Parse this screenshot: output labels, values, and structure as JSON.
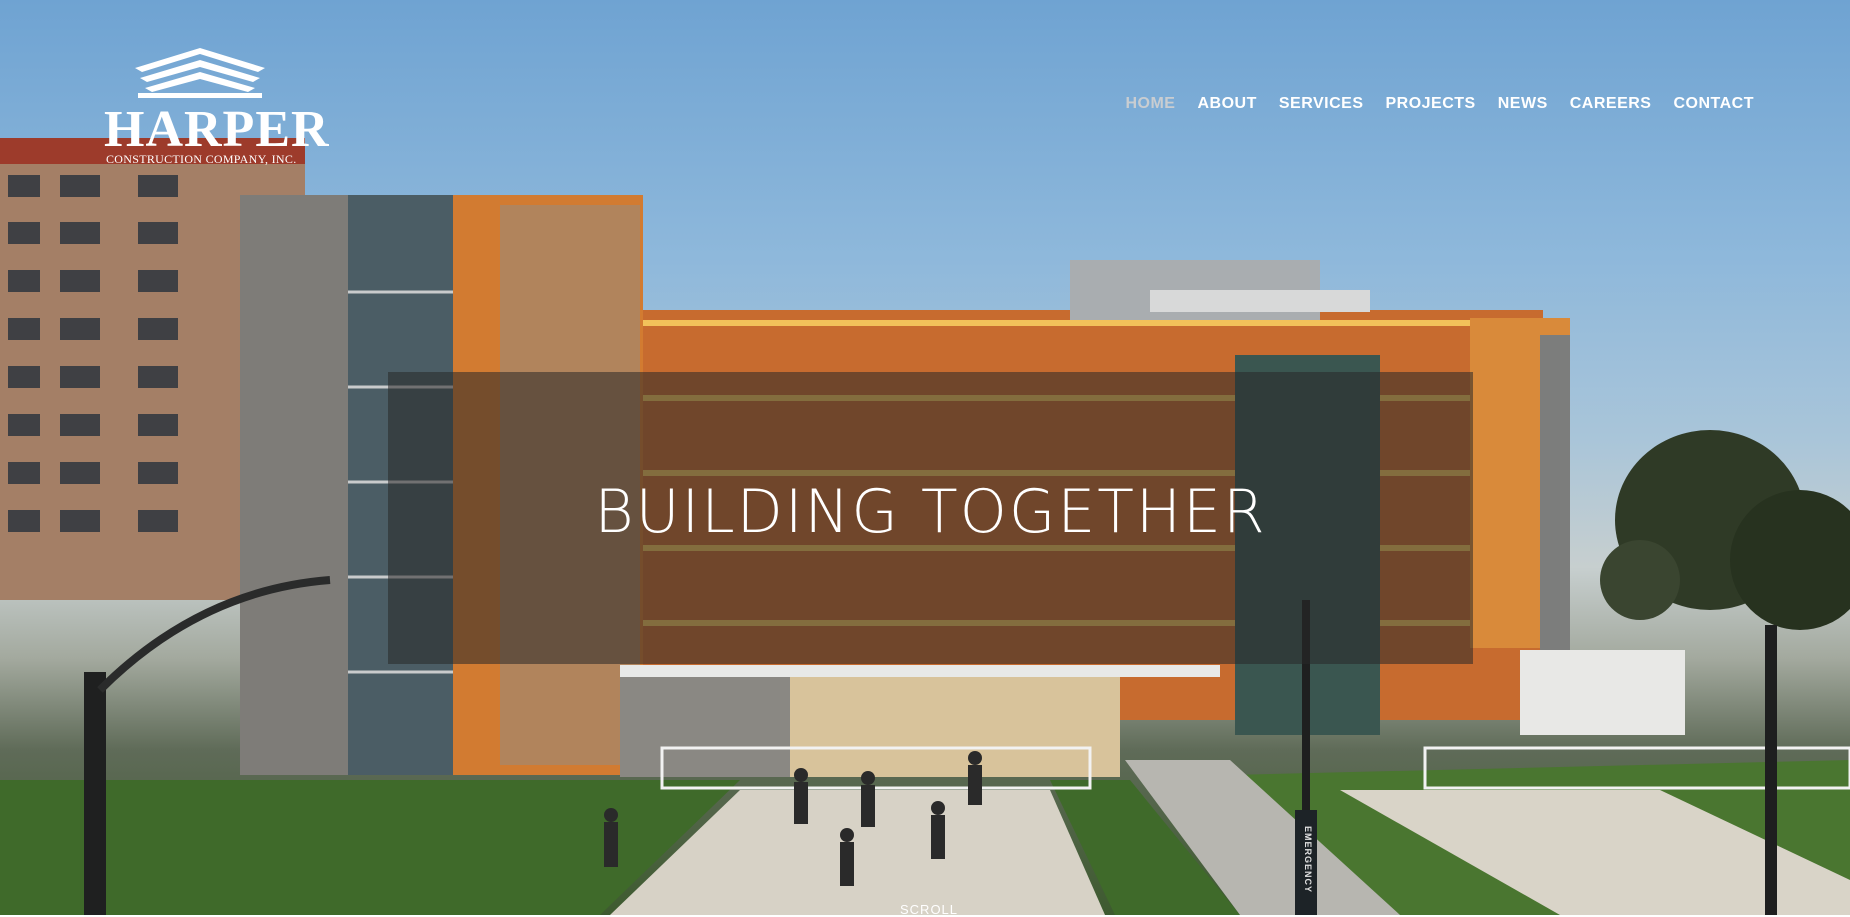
{
  "brand": {
    "name": "HARPER",
    "tagline": "CONSTRUCTION COMPANY, INC."
  },
  "nav": {
    "items": [
      {
        "label": "HOME",
        "active": true
      },
      {
        "label": "ABOUT",
        "active": false
      },
      {
        "label": "SERVICES",
        "active": false
      },
      {
        "label": "PROJECTS",
        "active": false
      },
      {
        "label": "NEWS",
        "active": false
      },
      {
        "label": "CAREERS",
        "active": false
      },
      {
        "label": "CONTACT",
        "active": false
      }
    ]
  },
  "hero": {
    "headline": "BUILDING TOGETHER",
    "scroll_label": "SCROLL",
    "sign_text": "EMERGENCY"
  },
  "colors": {
    "nav_text": "#ffffff",
    "nav_active": "#c9cdd1",
    "overlay": "rgba(40,40,40,0.55)"
  }
}
